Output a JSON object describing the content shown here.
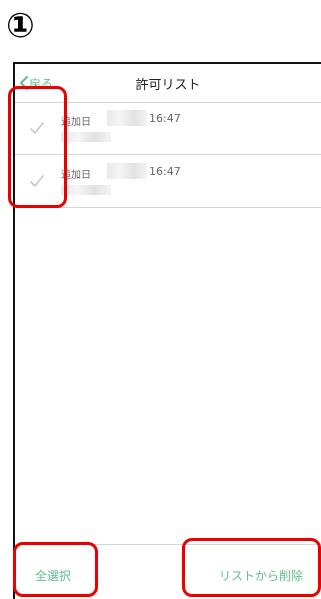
{
  "step_marker": "①",
  "navbar": {
    "back_label": "戻る",
    "title": "許可リスト"
  },
  "list": {
    "items": [
      {
        "label": "追加日",
        "time": "16:47"
      },
      {
        "label": "追加日",
        "time": "16:47"
      }
    ]
  },
  "toolbar": {
    "select_all_label": "全選択",
    "remove_label": "リストから削除"
  },
  "colors": {
    "accent": "#5fbf8f",
    "highlight": "#ea0000"
  }
}
